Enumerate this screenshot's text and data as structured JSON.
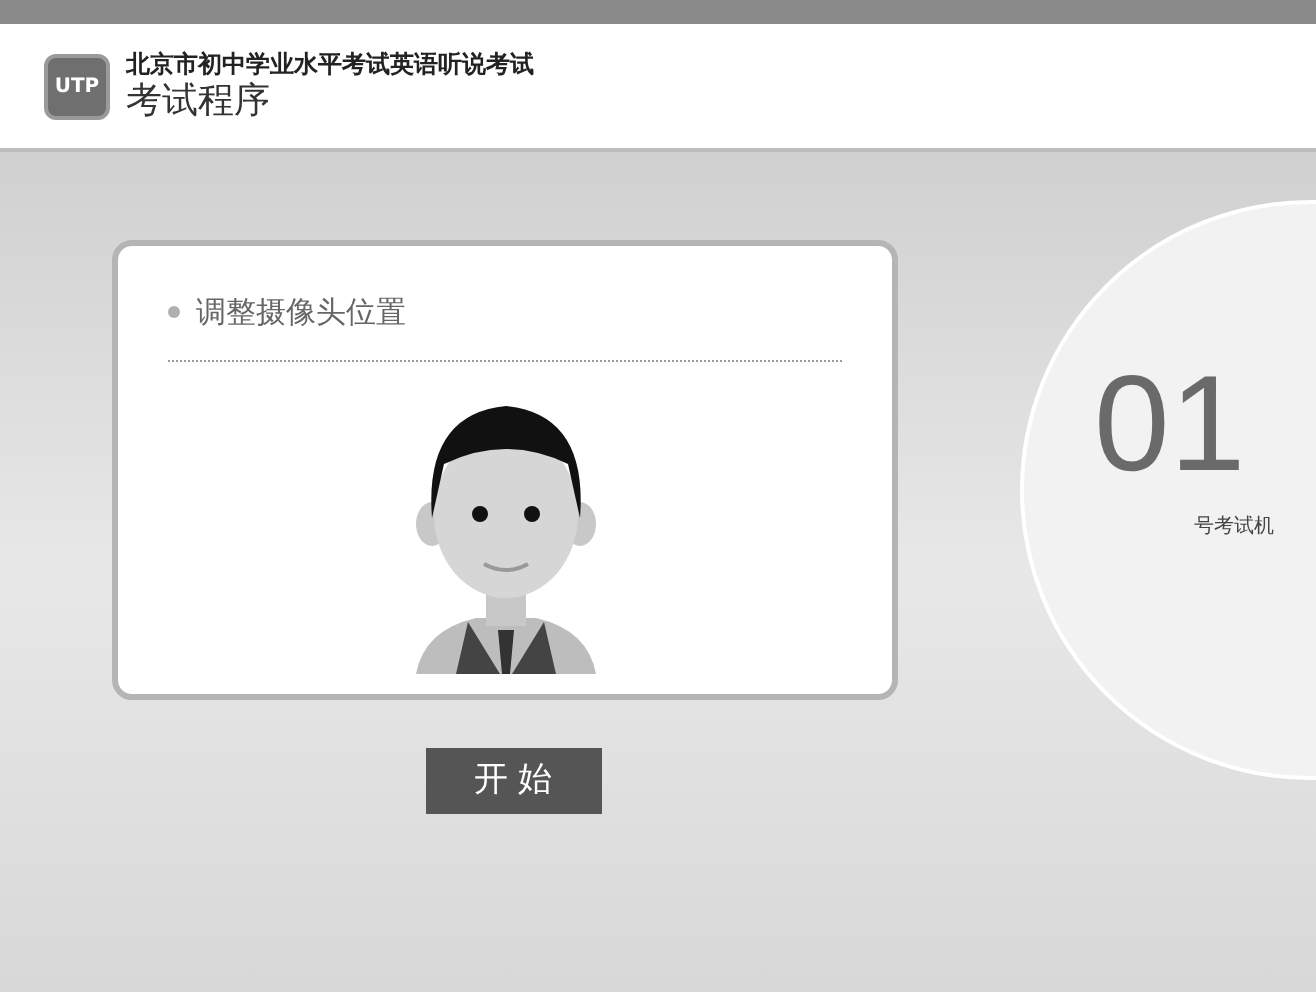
{
  "header": {
    "logo_text": "UTP",
    "subtitle": "北京市初中学业水平考试英语听说考试",
    "title": "考试程序"
  },
  "camera_card": {
    "instruction": "调整摄像头位置"
  },
  "start_button": {
    "label": "开 始"
  },
  "station": {
    "number": "01",
    "label": "号考试机"
  }
}
